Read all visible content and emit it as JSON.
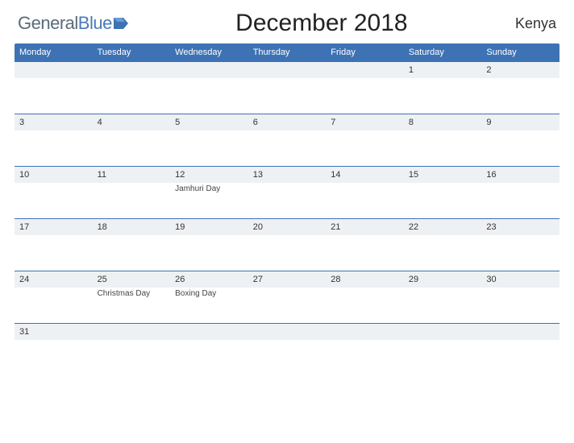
{
  "header": {
    "logo_general": "General",
    "logo_blue": "Blue",
    "title": "December 2018",
    "country": "Kenya"
  },
  "day_names": [
    "Monday",
    "Tuesday",
    "Wednesday",
    "Thursday",
    "Friday",
    "Saturday",
    "Sunday"
  ],
  "weeks": [
    {
      "dates": [
        "",
        "",
        "",
        "",
        "",
        "1",
        "2"
      ],
      "events": [
        "",
        "",
        "",
        "",
        "",
        "",
        ""
      ]
    },
    {
      "dates": [
        "3",
        "4",
        "5",
        "6",
        "7",
        "8",
        "9"
      ],
      "events": [
        "",
        "",
        "",
        "",
        "",
        "",
        ""
      ]
    },
    {
      "dates": [
        "10",
        "11",
        "12",
        "13",
        "14",
        "15",
        "16"
      ],
      "events": [
        "",
        "",
        "Jamhuri Day",
        "",
        "",
        "",
        ""
      ]
    },
    {
      "dates": [
        "17",
        "18",
        "19",
        "20",
        "21",
        "22",
        "23"
      ],
      "events": [
        "",
        "",
        "",
        "",
        "",
        "",
        ""
      ]
    },
    {
      "dates": [
        "24",
        "25",
        "26",
        "27",
        "28",
        "29",
        "30"
      ],
      "events": [
        "",
        "Christmas Day",
        "Boxing Day",
        "",
        "",
        "",
        ""
      ]
    },
    {
      "dates": [
        "31",
        "",
        "",
        "",
        "",
        "",
        ""
      ],
      "events": [
        "",
        "",
        "",
        "",
        "",
        "",
        ""
      ]
    }
  ]
}
